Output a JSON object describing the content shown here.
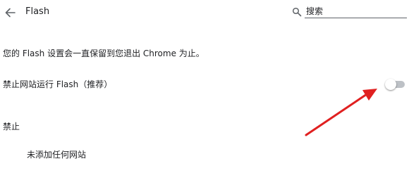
{
  "header": {
    "title": "Flash",
    "back_icon": "arrow-back-icon",
    "search": {
      "icon": "search-icon",
      "placeholder": "搜索",
      "value": ""
    }
  },
  "main": {
    "info_text": "您的 Flash 设置会一直保留到您退出 Chrome 为止。",
    "block_setting": {
      "label": "禁止网站运行 Flash（推荐）",
      "enabled": false
    },
    "block_section": {
      "title": "禁止",
      "empty_text": "未添加任何网站"
    }
  },
  "annotation": {
    "arrow_color": "#e02020"
  },
  "colors": {
    "text": "#202124",
    "icon": "#5f6368",
    "toggle_track_off": "#bdc1c6",
    "toggle_knob": "#ffffff"
  }
}
